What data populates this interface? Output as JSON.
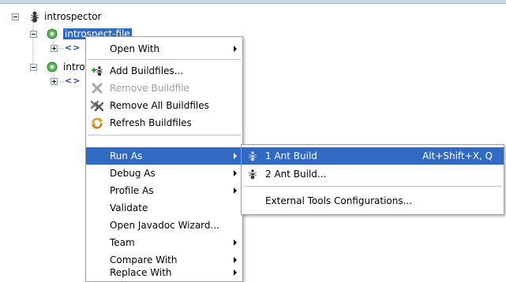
{
  "tree": {
    "root_label": "introspector",
    "nodes": [
      {
        "label": "introspect-file",
        "selected": true
      },
      {
        "label": "intro",
        "selected": false
      }
    ],
    "package_glyph": "<>"
  },
  "context_menu": {
    "items": [
      {
        "label": "Open With",
        "submenu": true
      },
      {
        "label": "Add Buildfiles...",
        "icon": "add-buildfiles-icon"
      },
      {
        "label": "Remove Buildfile",
        "icon": "remove-buildfile-icon",
        "disabled": true
      },
      {
        "label": "Remove All Buildfiles",
        "icon": "remove-all-buildfiles-icon"
      },
      {
        "label": "Refresh Buildfiles",
        "icon": "refresh-buildfiles-icon"
      },
      {
        "label": "Run As",
        "submenu": true,
        "highlighted": true
      },
      {
        "label": "Debug As",
        "submenu": true
      },
      {
        "label": "Profile As",
        "submenu": true
      },
      {
        "label": "Validate"
      },
      {
        "label": "Open Javadoc Wizard..."
      },
      {
        "label": "Team",
        "submenu": true
      },
      {
        "label": "Compare With",
        "submenu": true
      },
      {
        "label": "Replace With",
        "submenu": true
      }
    ]
  },
  "run_as_submenu": {
    "items": [
      {
        "label": "1 Ant Build",
        "shortcut": "Alt+Shift+X, Q",
        "icon": "ant-icon",
        "highlighted": true
      },
      {
        "label": "2 Ant Build...",
        "icon": "ant-icon"
      },
      {
        "label": "External Tools Configurations..."
      }
    ]
  },
  "colors": {
    "selection": "#316ac5",
    "menu_border": "#9c9c9c",
    "disabled_text": "#9d9d9d"
  }
}
